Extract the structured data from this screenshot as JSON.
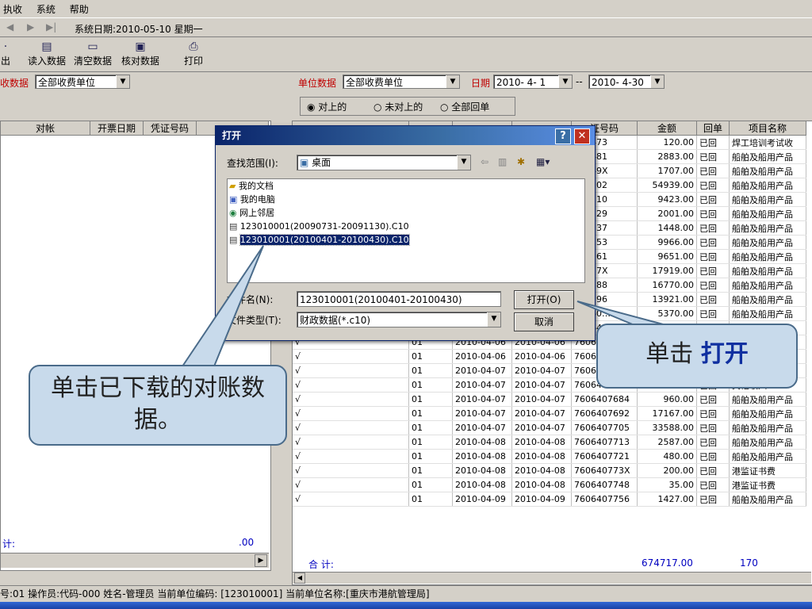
{
  "menu": [
    "执收",
    "系统",
    "帮助"
  ],
  "nav": {
    "system_date": "系统日期:2010-05-10 星期一"
  },
  "toolbar": [
    {
      "label": "出",
      "icon": "export-icon"
    },
    {
      "label": "读入数据",
      "icon": "read-data-icon"
    },
    {
      "label": "清空数据",
      "icon": "clear-data-icon"
    },
    {
      "label": "核对数据",
      "icon": "check-data-icon"
    },
    {
      "label": "打印",
      "icon": "print-icon"
    }
  ],
  "left": {
    "label": "收数据",
    "unit": "全部收费单位",
    "headers": [
      "对帐",
      "开票日期",
      "凭证号码",
      ""
    ],
    "total_label": "计:",
    "total_value": ".00"
  },
  "right": {
    "unit_label": "单位数据",
    "unit": "全部收费单位",
    "date_label": "日期",
    "date_from": "2010- 4- 1",
    "date_sep": "--",
    "date_to": "2010- 4-30",
    "radios": [
      "对上的",
      "未对上的",
      "全部回单"
    ],
    "headers": [
      "",
      "",
      "",
      "",
      "证号码",
      "金额",
      "回单",
      "项目名称"
    ],
    "top_rows": [
      [
        "407473",
        "120.00",
        "已回",
        "焊工培训考试收"
      ],
      [
        "407481",
        "2883.00",
        "已回",
        "船舶及船用产品"
      ],
      [
        "40749X",
        "1707.00",
        "已回",
        "船舶及船用产品"
      ],
      [
        "407502",
        "54939.00",
        "已回",
        "船舶及船用产品"
      ],
      [
        "407510",
        "9423.00",
        "已回",
        "船舶及船用产品"
      ],
      [
        "407529",
        "2001.00",
        "已回",
        "船舶及船用产品"
      ],
      [
        "407537",
        "1448.00",
        "已回",
        "船舶及船用产品"
      ],
      [
        "407553",
        "9966.00",
        "已回",
        "船舶及船用产品"
      ],
      [
        "407561",
        "9651.00",
        "已回",
        "船舶及船用产品"
      ],
      [
        "40757X",
        "17919.00",
        "已回",
        "船舶及船用产品"
      ],
      [
        "407588",
        "16770.00",
        "已回",
        "船舶及船用产品"
      ],
      [
        "407596",
        "13921.00",
        "已回",
        "船舶及船用产品"
      ],
      [
        "40760…",
        "5370.00",
        "已回",
        "船舶及船用产品"
      ]
    ],
    "rows": [
      [
        "√",
        "01",
        "2010-04-06",
        "2010-04-06",
        "760640…",
        "",
        "",
        "品"
      ],
      [
        "√",
        "01",
        "2010-04-06",
        "2010-04-06",
        "760640…",
        "",
        "",
        "品"
      ],
      [
        "√",
        "01",
        "2010-04-06",
        "2010-04-06",
        "760640…",
        "",
        "",
        "品"
      ],
      [
        "√",
        "01",
        "2010-04-07",
        "2010-04-07",
        "7606407668",
        "17945.00",
        "已回",
        "船舶及船用产品"
      ],
      [
        "√",
        "01",
        "2010-04-07",
        "2010-04-07",
        "7606407676",
        "40.00",
        "已回",
        "其他收入"
      ],
      [
        "√",
        "01",
        "2010-04-07",
        "2010-04-07",
        "7606407684",
        "960.00",
        "已回",
        "船舶及船用产品"
      ],
      [
        "√",
        "01",
        "2010-04-07",
        "2010-04-07",
        "7606407692",
        "17167.00",
        "已回",
        "船舶及船用产品"
      ],
      [
        "√",
        "01",
        "2010-04-07",
        "2010-04-07",
        "7606407705",
        "33588.00",
        "已回",
        "船舶及船用产品"
      ],
      [
        "√",
        "01",
        "2010-04-08",
        "2010-04-08",
        "7606407713",
        "2587.00",
        "已回",
        "船舶及船用产品"
      ],
      [
        "√",
        "01",
        "2010-04-08",
        "2010-04-08",
        "7606407721",
        "480.00",
        "已回",
        "船舶及船用产品"
      ],
      [
        "√",
        "01",
        "2010-04-08",
        "2010-04-08",
        "760640773X",
        "200.00",
        "已回",
        "港监证书费"
      ],
      [
        "√",
        "01",
        "2010-04-08",
        "2010-04-08",
        "7606407748",
        "35.00",
        "已回",
        "港监证书费"
      ],
      [
        "√",
        "01",
        "2010-04-09",
        "2010-04-09",
        "7606407756",
        "1427.00",
        "已回",
        "船舶及船用产品"
      ]
    ],
    "total_label": "合 计:",
    "total_amount": "674717.00",
    "total_count": "170"
  },
  "dialog": {
    "title": "打开",
    "lookin_label": "查找范围(I):",
    "lookin_value": "桌面",
    "files": [
      {
        "name": "我的文档",
        "icon": "folder-icon"
      },
      {
        "name": "我的电脑",
        "icon": "computer-icon"
      },
      {
        "name": "网上邻居",
        "icon": "network-icon"
      },
      {
        "name": "123010001(20090731-20091130).C10",
        "icon": "file-icon"
      },
      {
        "name": "123010001(20100401-20100430).C10",
        "icon": "file-icon",
        "selected": true
      }
    ],
    "filename_label": "文件名(N):",
    "filename_value": "123010001(20100401-20100430)",
    "filetype_label": "文件类型(T):",
    "filetype_value": "财政数据(*.c10)",
    "open_button": "打开(O)",
    "cancel_button": "取消"
  },
  "callouts": {
    "left_text": "单击已下载的对账数据。",
    "right_text_prefix": "单击 ",
    "right_text_bold": "打开"
  },
  "status": {
    "text": "号:01   操作员:代码-000 姓名-管理员  当前单位编码: [123010001]  当前单位名称:[重庆市港航管理局]"
  }
}
